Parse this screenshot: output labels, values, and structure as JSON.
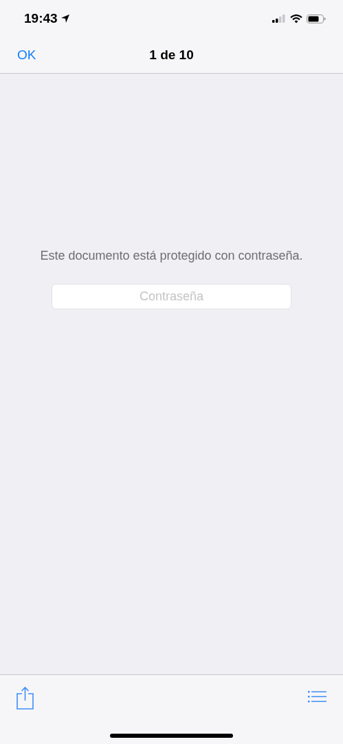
{
  "status_bar": {
    "time": "19:43"
  },
  "nav_bar": {
    "done_button": "OK",
    "title": "1 de 10"
  },
  "content": {
    "message": "Este documento está protegido con contraseña.",
    "password_field": {
      "placeholder": "Contraseña"
    }
  }
}
